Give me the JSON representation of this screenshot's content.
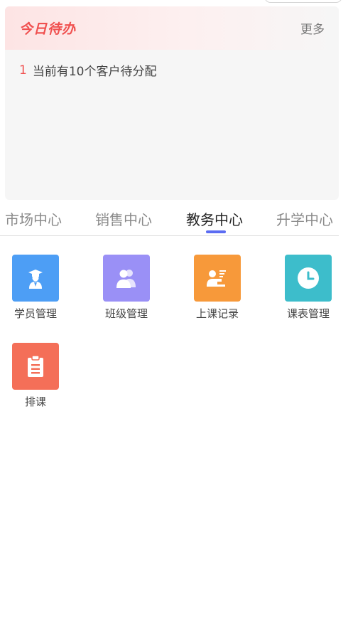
{
  "todo": {
    "title": "今日待办",
    "more_label": "更多",
    "items": [
      {
        "index": "1",
        "text": "当前有10个客户待分配"
      }
    ]
  },
  "tabs": [
    {
      "label": "市场中心",
      "active": false
    },
    {
      "label": "销售中心",
      "active": false
    },
    {
      "label": "教务中心",
      "active": true
    },
    {
      "label": "升学中心",
      "active": false
    }
  ],
  "grid": [
    {
      "label": "学员管理",
      "icon": "student-icon",
      "color": "#4d9ef5"
    },
    {
      "label": "班级管理",
      "icon": "class-icon",
      "color": "#9a90f6"
    },
    {
      "label": "上课记录",
      "icon": "teaching-record-icon",
      "color": "#f7993a"
    },
    {
      "label": "课表管理",
      "icon": "clock-icon",
      "color": "#3dbdcb"
    },
    {
      "label": "排课",
      "icon": "clipboard-icon",
      "color": "#f46f58"
    }
  ],
  "colors": {
    "accent": "#5b6cf2",
    "todo_title": "#f0504f"
  }
}
